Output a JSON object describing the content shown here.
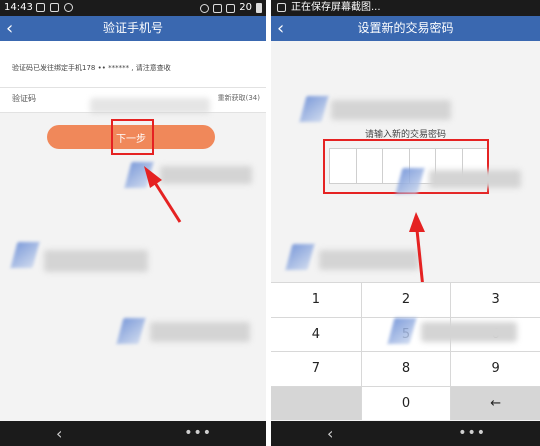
{
  "left_screen": {
    "status_bar": {
      "time": "14:43",
      "battery_level": "20"
    },
    "title": "验证手机号",
    "back_icon": "back-chevron-icon",
    "info_text": "验证码已发往绑定手机178 •• ****** , 请注意查收",
    "code_label": "验证码",
    "code_placeholder": "",
    "resend_label": "重新获取(34)",
    "next_button_label": "下一步",
    "nav": {
      "back": "‹",
      "menu": "•••"
    }
  },
  "right_screen": {
    "status_bar": {
      "text": "正在保存屏幕截图..."
    },
    "title": "设置新的交易密码",
    "back_icon": "back-chevron-icon",
    "prompt": "请输入新的交易密码",
    "password_cells": 6,
    "keypad": {
      "keys": [
        "1",
        "2",
        "3",
        "4",
        "5",
        "6",
        "7",
        "8",
        "9",
        "",
        "0",
        "←"
      ]
    },
    "nav": {
      "back": "‹",
      "menu": "•••"
    }
  },
  "colors": {
    "title_bar": "#3a68b0",
    "next_button": "#f0885a",
    "highlight_box": "#e52222",
    "arrow": "#e52222",
    "status_bar": "#1b1b1b"
  }
}
